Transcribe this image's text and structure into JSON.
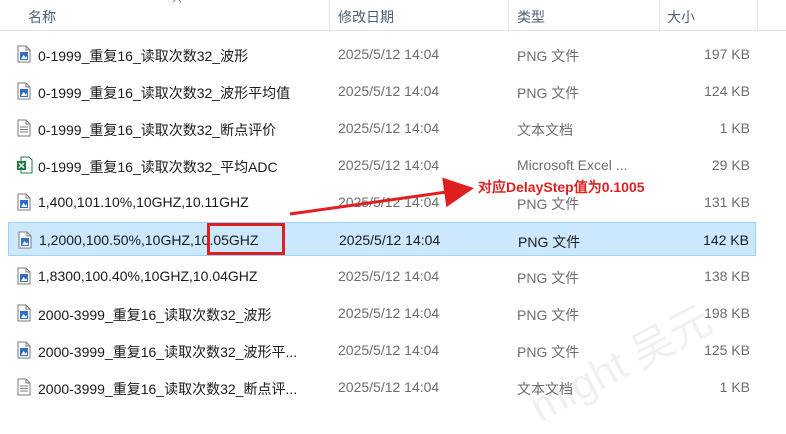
{
  "columns": {
    "name": "名称",
    "date": "修改日期",
    "type": "类型",
    "size": "大小"
  },
  "files": [
    {
      "name": "0-1999_重复16_读取次数32_波形",
      "date": "2025/5/12 14:04",
      "type": "PNG 文件",
      "size": "197 KB",
      "icon": "png-file-icon"
    },
    {
      "name": "0-1999_重复16_读取次数32_波形平均值",
      "date": "2025/5/12 14:04",
      "type": "PNG 文件",
      "size": "124 KB",
      "icon": "png-file-icon"
    },
    {
      "name": "0-1999_重复16_读取次数32_断点评价",
      "date": "2025/5/12 14:04",
      "type": "文本文档",
      "size": "1 KB",
      "icon": "text-file-icon"
    },
    {
      "name": "0-1999_重复16_读取次数32_平均ADC",
      "date": "2025/5/12 14:04",
      "type": "Microsoft Excel ...",
      "size": "29 KB",
      "icon": "excel-file-icon"
    },
    {
      "name": "1,400,101.10%,10GHZ,10.11GHZ",
      "date": "2025/5/12 14:04",
      "type": "PNG 文件",
      "size": "131 KB",
      "icon": "png-file-icon"
    },
    {
      "name": "1,2000,100.50%,10GHZ,10.05GHZ",
      "date": "2025/5/12 14:04",
      "type": "PNG 文件",
      "size": "142 KB",
      "icon": "png-file-icon",
      "selected": true
    },
    {
      "name": "1,8300,100.40%,10GHZ,10.04GHZ",
      "date": "2025/5/12 14:04",
      "type": "PNG 文件",
      "size": "138 KB",
      "icon": "png-file-icon"
    },
    {
      "name": "2000-3999_重复16_读取次数32_波形",
      "date": "2025/5/12 14:04",
      "type": "PNG 文件",
      "size": "198 KB",
      "icon": "png-file-icon"
    },
    {
      "name": "2000-3999_重复16_读取次数32_波形平...",
      "date": "2025/5/12 14:04",
      "type": "PNG 文件",
      "size": "125 KB",
      "icon": "png-file-icon"
    },
    {
      "name": "2000-3999_重复16_读取次数32_断点评...",
      "date": "2025/5/12 14:04",
      "type": "文本文档",
      "size": "1 KB",
      "icon": "text-file-icon"
    }
  ],
  "annotation": {
    "text": "对应DelayStep值为0.1005",
    "color": "#e02020"
  },
  "colors": {
    "selection": "#cce8ff",
    "selection_border": "#99d1ff",
    "header_text": "#4c607a"
  }
}
